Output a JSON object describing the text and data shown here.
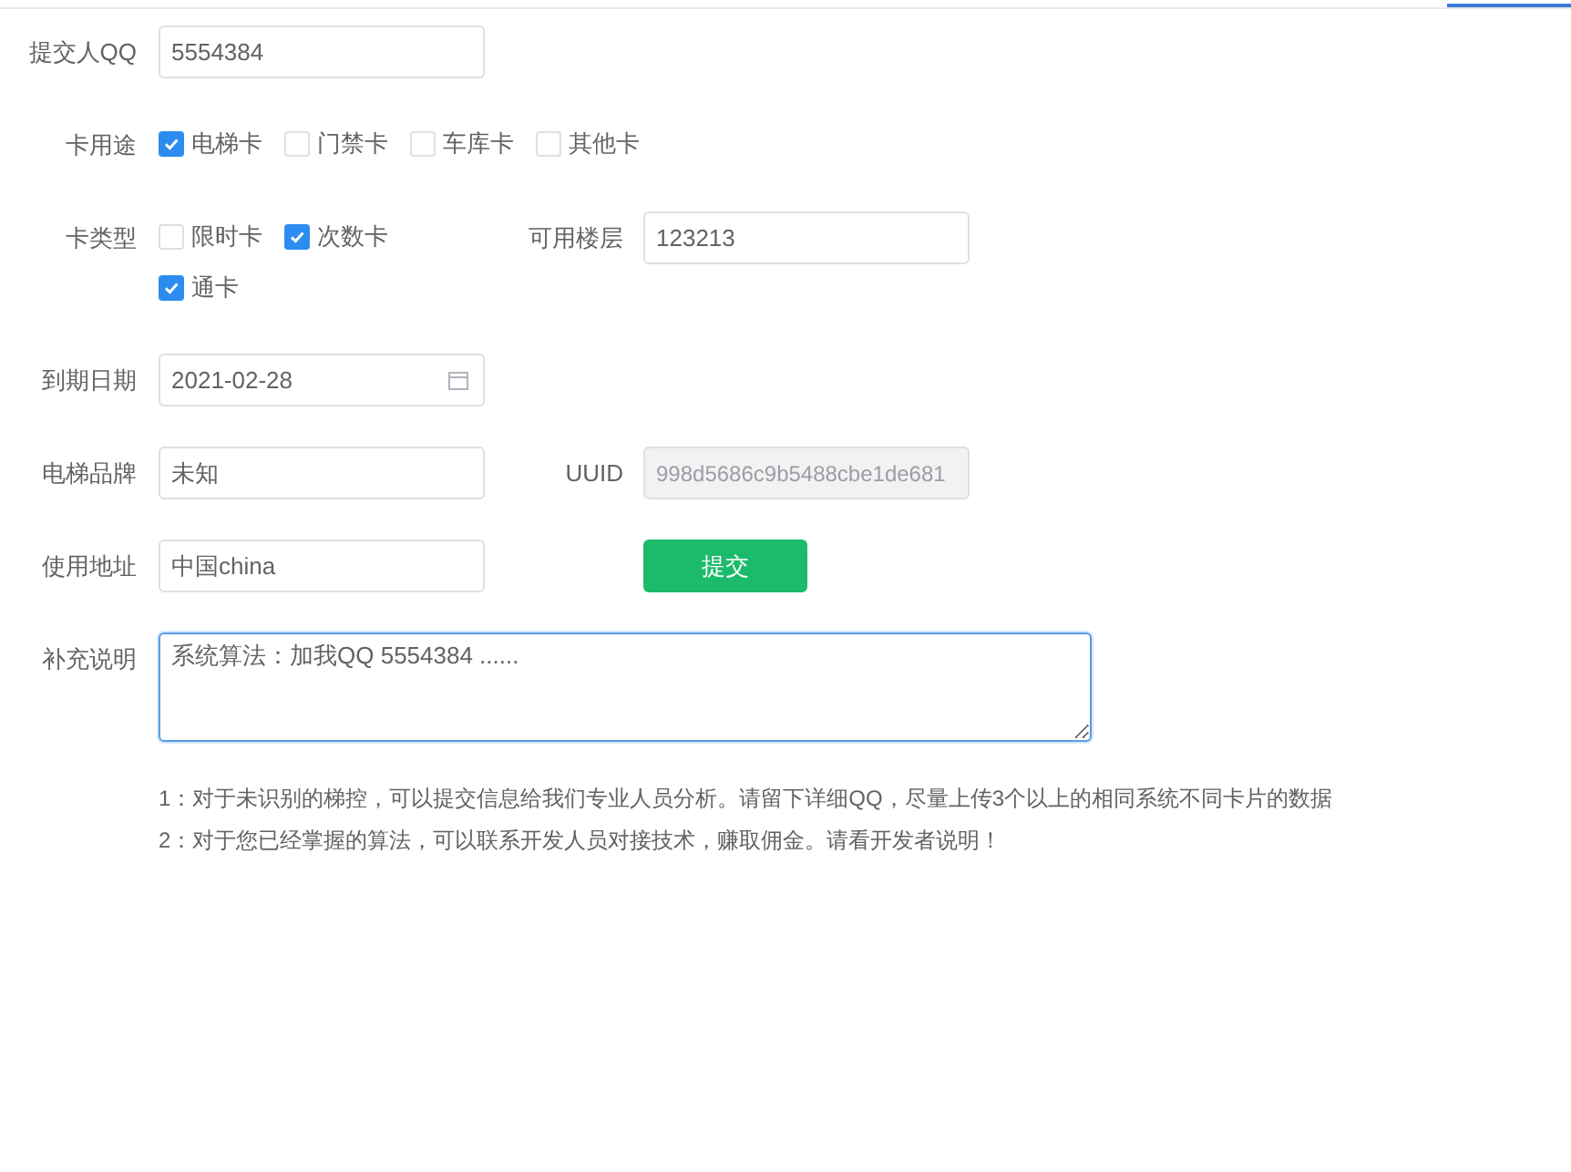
{
  "submitter_qq": {
    "label": "提交人QQ",
    "value": "5554384"
  },
  "card_use": {
    "label": "卡用途",
    "options": [
      {
        "label": "电梯卡",
        "checked": true
      },
      {
        "label": "门禁卡",
        "checked": false
      },
      {
        "label": "车库卡",
        "checked": false
      },
      {
        "label": "其他卡",
        "checked": false
      }
    ]
  },
  "card_type": {
    "label": "卡类型",
    "options": [
      {
        "label": "限时卡",
        "checked": false
      },
      {
        "label": "次数卡",
        "checked": true
      },
      {
        "label": "通卡",
        "checked": true
      }
    ]
  },
  "floors": {
    "label": "可用楼层",
    "value": "123213"
  },
  "expiry_date": {
    "label": "到期日期",
    "value": "2021-02-28"
  },
  "elevator_brand": {
    "label": "电梯品牌",
    "value": "未知"
  },
  "uuid": {
    "label": "UUID",
    "value": "998d5686c9b5488cbe1de681",
    "disabled": true
  },
  "address": {
    "label": "使用地址",
    "value": "中国china"
  },
  "submit_button": "提交",
  "remarks": {
    "label": "补充说明",
    "value": "系统算法：加我QQ 5554384 ......",
    "focused": true
  },
  "notes": [
    "1：对于未识别的梯控，可以提交信息给我们专业人员分析。请留下详细QQ，尽量上传3个以上的相同系统不同卡片的数据",
    "2：对于您已经掌握的算法，可以联系开发人员对接技术，赚取佣金。请看开发者说明！"
  ]
}
